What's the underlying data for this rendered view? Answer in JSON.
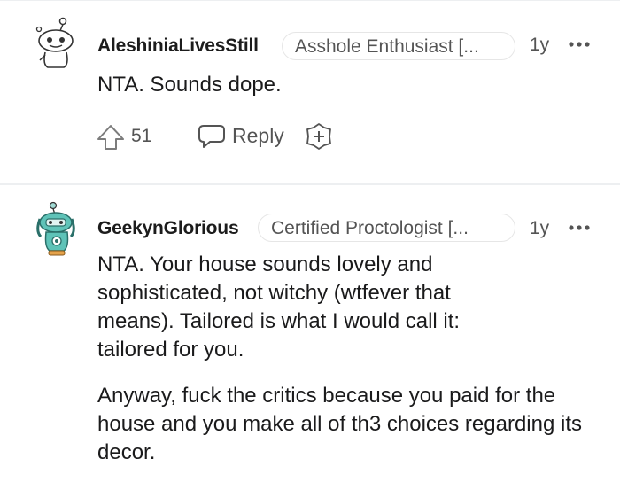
{
  "comments": [
    {
      "username": "AleshiniaLivesStill",
      "flair": "Asshole Enthusiast [...",
      "age": "1y",
      "paragraphs": [
        "NTA. Sounds dope."
      ],
      "upvotes": "51",
      "reply_label": "Reply",
      "avatar_icon": "snoo-avatar-default",
      "accent": "#d7dadc"
    },
    {
      "username": "GeekynGlorious",
      "flair": "Certified Proctologist [...",
      "age": "1y",
      "paragraphs": [
        "NTA. Your house sounds lovely and sophisticated, not witchy (wtfever that means). Tailored is what I would call it: tailored for you.",
        "Anyway, fuck the critics because you paid for the house and you make all of th3 choices regarding its decor."
      ],
      "avatar_icon": "snoo-avatar-teal",
      "accent": "#3aa6a0"
    }
  ]
}
